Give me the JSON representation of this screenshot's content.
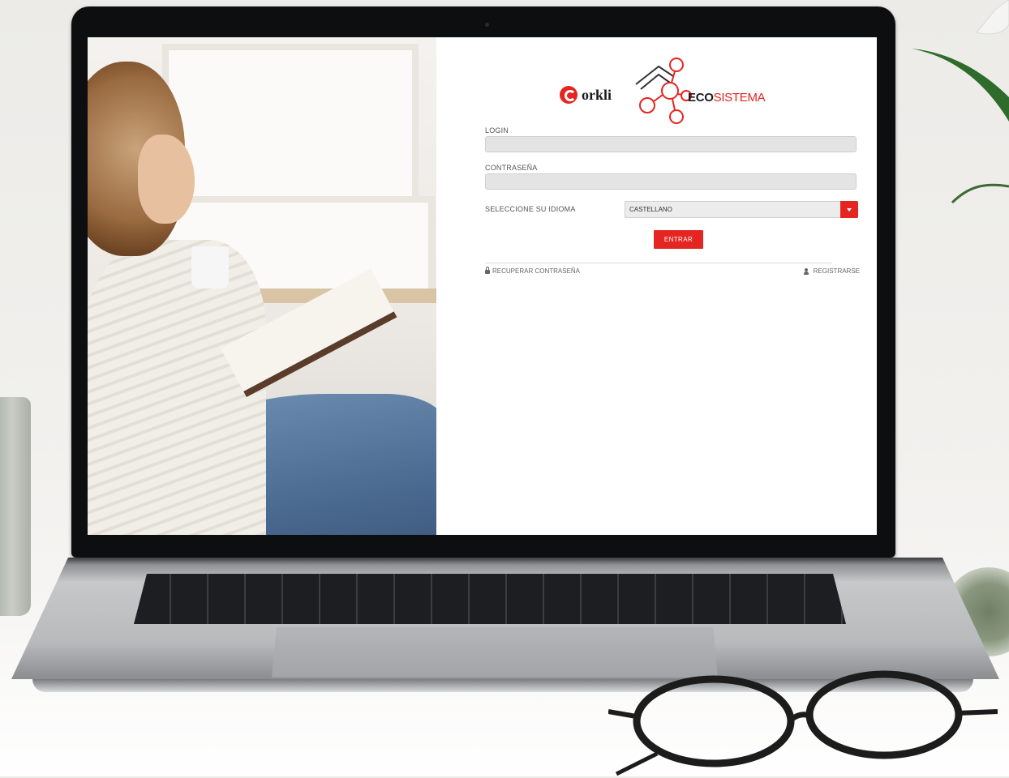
{
  "brand": {
    "company": "orkli",
    "product_bold": "ECO",
    "product_light": "SISTEMA",
    "accent_color": "#e42521"
  },
  "form": {
    "login_label": "LOGIN",
    "login_value": "",
    "password_label": "CONTRASEÑA",
    "password_value": "",
    "language_label": "SELECCIONE SU IDIOMA",
    "language_selected": "CASTELLANO",
    "submit_label": "ENTRAR"
  },
  "links": {
    "recover_password": "RECUPERAR CONTRASEÑA",
    "recover_icon": "lock-icon",
    "register": "REGISTRARSE",
    "register_icon": "user-plus-icon"
  }
}
